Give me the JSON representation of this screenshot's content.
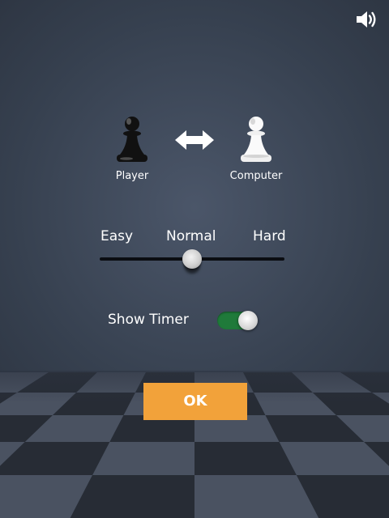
{
  "sound": {
    "icon": "speaker-volume-icon",
    "muted": false
  },
  "sides": {
    "player": {
      "label": "Player",
      "piece_color": "black",
      "icon": "black-pawn-icon"
    },
    "computer": {
      "label": "Computer",
      "piece_color": "white",
      "icon": "white-pawn-icon"
    },
    "swap_icon": "double-arrow-swap-icon"
  },
  "difficulty": {
    "options": [
      "Easy",
      "Normal",
      "Hard"
    ],
    "selected": "Normal",
    "slider_value": 0.5
  },
  "timer": {
    "label": "Show Timer",
    "enabled": true
  },
  "ok_button": {
    "label": "OK"
  },
  "colors": {
    "accent_button": "#f2a23a",
    "toggle_on": "#1f7a3a",
    "background": "#3a4454"
  }
}
